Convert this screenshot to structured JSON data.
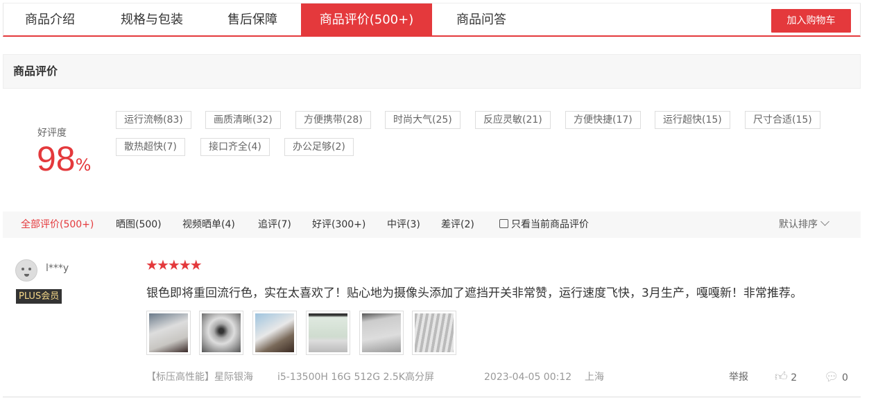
{
  "tabs": [
    {
      "label": "商品介绍"
    },
    {
      "label": "规格与包装"
    },
    {
      "label": "售后保障"
    },
    {
      "label": "商品评价(500+)"
    },
    {
      "label": "商品问答"
    }
  ],
  "cart_button": "加入购物车",
  "section_title": "商品评价",
  "rating": {
    "label": "好评度",
    "value": "98",
    "unit": "%"
  },
  "tags": [
    "运行流畅(83)",
    "画质清晰(32)",
    "方便携带(28)",
    "时尚大气(25)",
    "反应灵敏(21)",
    "方便快捷(17)",
    "运行超快(15)",
    "尺寸合适(15)",
    "散热超快(7)",
    "接口齐全(4)",
    "办公足够(2)"
  ],
  "filters": [
    "全部评价(500+)",
    "晒图(500)",
    "视频晒单(4)",
    "追评(7)",
    "好评(300+)",
    "中评(3)",
    "差评(2)"
  ],
  "only_current_label": "只看当前商品评价",
  "sort_label": "默认排序",
  "review": {
    "user": "l***y",
    "badge": "PLUS会员",
    "stars": 5,
    "text": "银色即将重回流行色，实在太喜欢了！贴心地为摄像头添加了遮挡开关非常赞，运行速度飞快，3月生产，嘎嘎新！非常推荐。",
    "variant": "【标压高性能】星际银海",
    "spec": "i5-13500H 16G 512G 2.5K高分屏",
    "date": "2023-04-05 00:12",
    "location": "上海",
    "report": "举报",
    "likes": "2",
    "comments": "0"
  },
  "colors": {
    "accent": "#e4393c"
  }
}
